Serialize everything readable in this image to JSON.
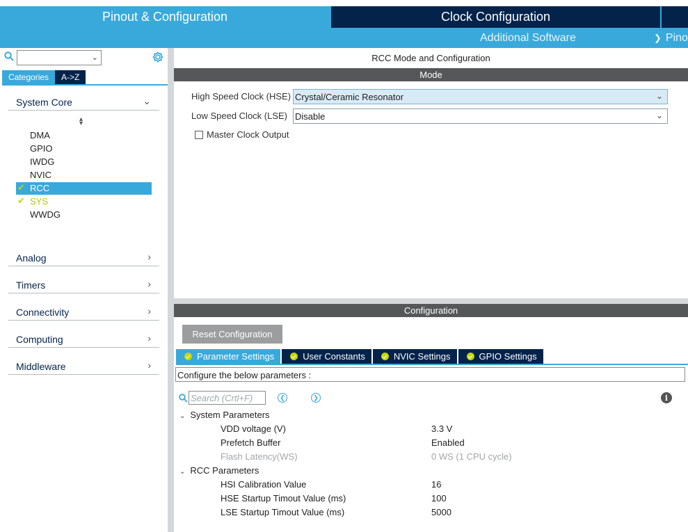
{
  "top_tabs": {
    "pinout": "Pinout & Configuration",
    "clock": "Clock Configuration",
    "additional_software": "Additional Software",
    "pinout_view": "Pino"
  },
  "left_panel": {
    "tabs": {
      "categories": "Categories",
      "az": "A->Z"
    },
    "categories": [
      {
        "label": "System Core",
        "expanded": true
      },
      {
        "label": "Analog"
      },
      {
        "label": "Timers"
      },
      {
        "label": "Connectivity"
      },
      {
        "label": "Computing"
      },
      {
        "label": "Middleware"
      }
    ],
    "peripherals": [
      {
        "label": "DMA",
        "state": "none"
      },
      {
        "label": "GPIO",
        "state": "none"
      },
      {
        "label": "IWDG",
        "state": "none"
      },
      {
        "label": "NVIC",
        "state": "none"
      },
      {
        "label": "RCC",
        "state": "selected-ok"
      },
      {
        "label": "SYS",
        "state": "ok"
      },
      {
        "label": "WWDG",
        "state": "none"
      }
    ]
  },
  "right_panel": {
    "title": "RCC Mode and Configuration",
    "mode_header": "Mode",
    "hse_label": "High Speed Clock (HSE)",
    "hse_value": "Crystal/Ceramic Resonator",
    "lse_label": "Low Speed Clock (LSE)",
    "lse_value": "Disable",
    "mco_label": "Master Clock Output",
    "mco_checked": false,
    "config_header": "Configuration",
    "reset_button": "Reset Configuration",
    "config_tabs": [
      "Parameter Settings",
      "User Constants",
      "NVIC Settings",
      "GPIO Settings"
    ],
    "config_description": "Configure the below parameters :",
    "search_placeholder": "Search (Crtl+F)",
    "groups": [
      {
        "label": "System Parameters",
        "params": [
          {
            "name": "VDD voltage (V)",
            "value": "3.3 V",
            "disabled": false
          },
          {
            "name": "Prefetch Buffer",
            "value": "Enabled",
            "disabled": false
          },
          {
            "name": "Flash Latency(WS)",
            "value": "0 WS (1 CPU cycle)",
            "disabled": true
          }
        ]
      },
      {
        "label": "RCC Parameters",
        "params": [
          {
            "name": "HSI Calibration Value",
            "value": "16",
            "disabled": false
          },
          {
            "name": "HSE Startup Timout Value (ms)",
            "value": "100",
            "disabled": false
          },
          {
            "name": "LSE Startup Timout Value (ms)",
            "value": "5000",
            "disabled": false
          }
        ]
      }
    ]
  },
  "colors": {
    "accent": "#39a9dc",
    "dark_navy": "#03234b",
    "ok_green": "#c4d600",
    "bar_gray": "#555758"
  }
}
